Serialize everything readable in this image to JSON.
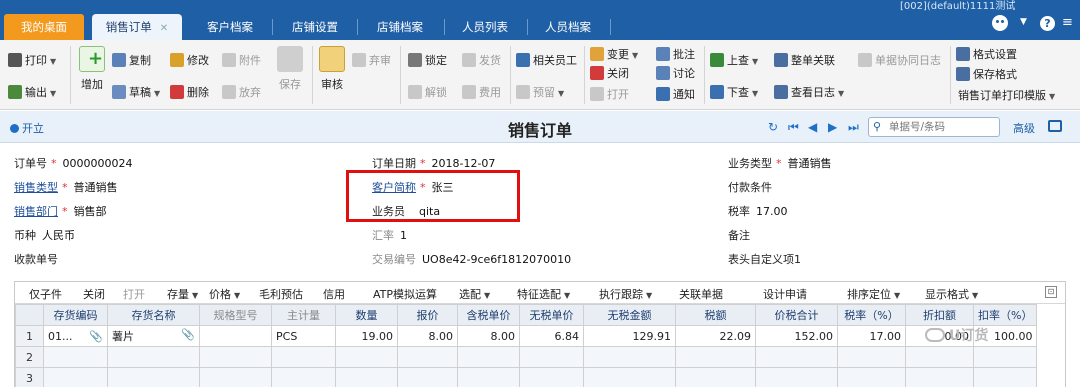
{
  "top_tabs": {
    "home": "我的桌面",
    "active": "销售订单",
    "items": [
      "客户档案",
      "店铺设置",
      "店铺档案",
      "人员列表",
      "人员档案"
    ],
    "env_text": "[002](default)1111测试"
  },
  "toolbar": {
    "print": "打印",
    "export": "输出",
    "add": "增加",
    "copy": "复制",
    "draft": "草稿",
    "modify": "修改",
    "delete": "删除",
    "attach": "附件",
    "discard": "放弃",
    "save": "保存",
    "audit": "审核",
    "abandon": "弃审",
    "lock": "锁定",
    "unlock": "解锁",
    "ship": "发货",
    "fee": "费用",
    "staff": "相关员工",
    "presale": "预留",
    "change": "变更",
    "close": "关闭",
    "open": "打开",
    "annotate": "批注",
    "discuss": "讨论",
    "notify": "通知",
    "prev": "上查",
    "next": "下查",
    "link": "整单关联",
    "log": "查看日志",
    "collab_log": "单据协同日志",
    "format_setting": "格式设置",
    "save_format": "保存格式",
    "print_template": "销售订单打印模版"
  },
  "titlebar": {
    "open_label": "开立",
    "title": "销售订单",
    "search_placeholder": "单据号/条码",
    "advanced": "高级"
  },
  "form": {
    "order_no_label": "订单号",
    "order_no": "0000000024",
    "order_date_label": "订单日期",
    "order_date": "2018-12-07",
    "biz_type_label": "业务类型",
    "biz_type": "普通销售",
    "sales_type_label": "销售类型",
    "sales_type": "普通销售",
    "customer_label": "客户简称",
    "customer": "张三",
    "payment_label": "付款条件",
    "payment": "",
    "dept_label": "销售部门",
    "dept": "销售部",
    "salesman_label": "业务员",
    "salesman": "qita",
    "tax_rate_label": "税率",
    "tax_rate": "17.00",
    "currency_label": "币种",
    "currency": "人民币",
    "exchange_label": "汇率",
    "exchange": "1",
    "remark_label": "备注",
    "remark": "",
    "receipt_label": "收款单号",
    "receipt": "",
    "txn_label": "交易编号",
    "txn": "UO8e42-9ce6f1812070010",
    "custom1_label": "表头自定义项1",
    "custom1": ""
  },
  "grid_toolbar": [
    "仅子件",
    "关闭",
    "打开",
    "存量",
    "价格",
    "毛利预估",
    "信用",
    "ATP模拟运算",
    "选配",
    "特征选配",
    "执行跟踪",
    "关联单据",
    "设计申请",
    "排序定位",
    "显示格式"
  ],
  "table": {
    "headers": [
      "存货编码",
      "存货名称",
      "规格型号",
      "主计量",
      "数量",
      "报价",
      "含税单价",
      "无税单价",
      "无税金额",
      "税额",
      "价税合计",
      "税率（%）",
      "折扣额",
      "扣率（%）"
    ],
    "rows": [
      [
        "01...",
        "薯片",
        "",
        "PCS",
        "19.00",
        "8.00",
        "8.00",
        "6.84",
        "129.91",
        "22.09",
        "152.00",
        "17.00",
        "0.00",
        "100.00"
      ]
    ],
    "row_numbers": [
      "1",
      "2",
      "3"
    ]
  },
  "watermark": "U订货",
  "colors": {
    "topbar": "#1f5fa6",
    "home_tab": "#f39a1e",
    "highlight": "#e01010"
  }
}
